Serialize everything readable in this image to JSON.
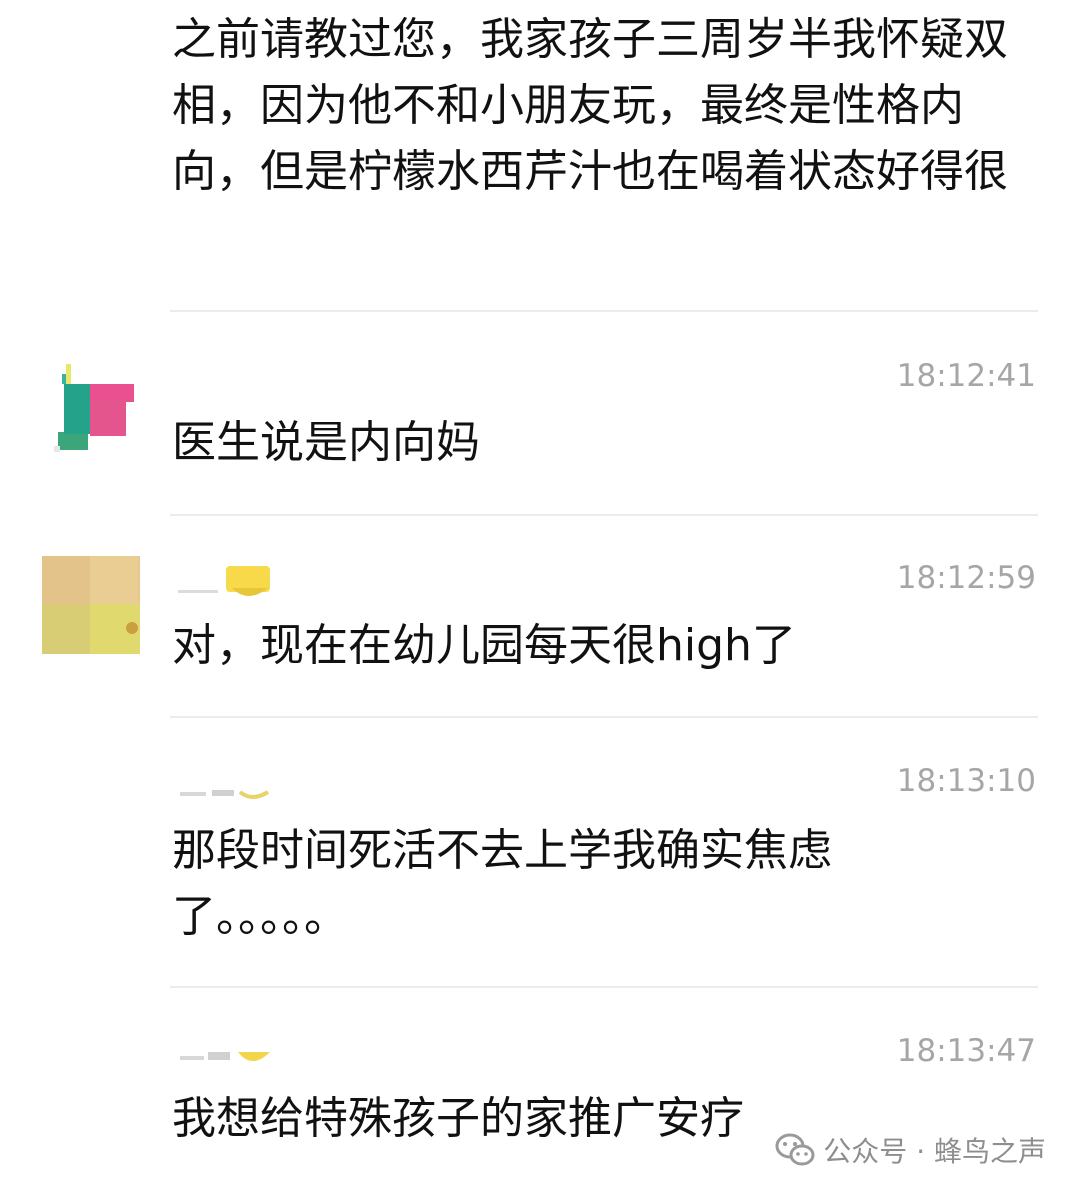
{
  "chat": {
    "messages": [
      {
        "text": "之前请教过您，我家孩子三周岁半我怀疑双相，因为他不和小朋友玩，最终是性格内向，但是柠檬水西芹汁也在喝着状态好得很"
      },
      {
        "time": "18:12:41",
        "text": "医生说是内向妈"
      },
      {
        "time": "18:12:59",
        "text": "对，现在在幼儿园每天很high了"
      },
      {
        "time": "18:13:10",
        "text": "那段时间死活不去上学我确实焦虑了。。。。。"
      },
      {
        "time": "18:13:47",
        "text": "我想给特殊孩子的家推广安疗"
      }
    ]
  },
  "watermark": {
    "label": "公众号 · 蜂鸟之声",
    "icon": "wechat-icon"
  },
  "colors": {
    "text": "#111111",
    "timestamp": "#a6a6a6",
    "divider": "#ececec",
    "watermark": "#8e8e8e"
  }
}
